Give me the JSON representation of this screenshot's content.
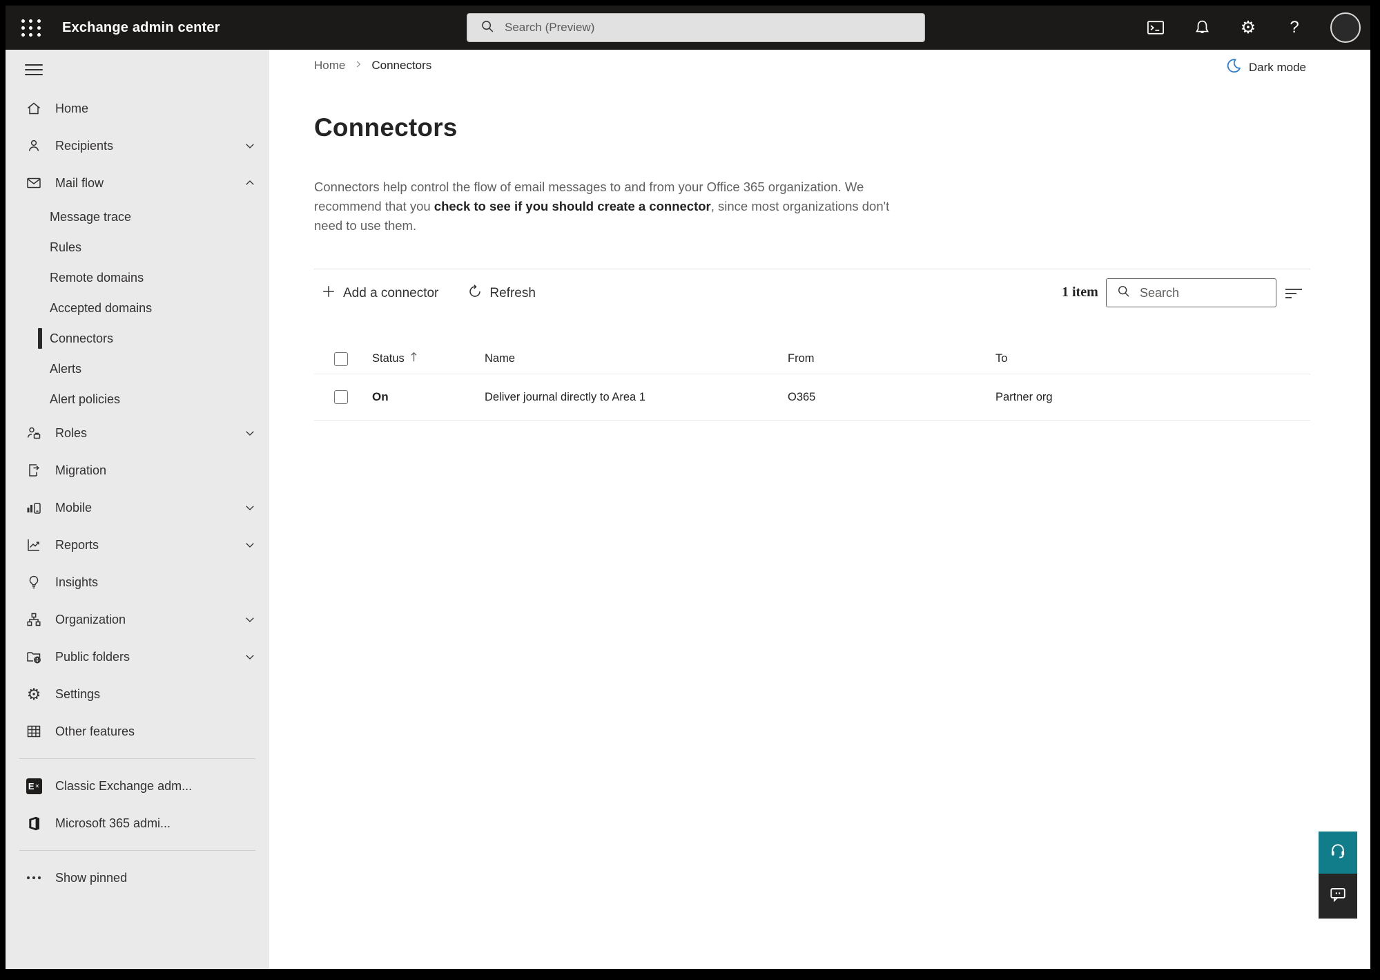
{
  "topbar": {
    "title": "Exchange admin center",
    "search_placeholder": "Search (Preview)",
    "help_label": "?",
    "gear_glyph": "⚙"
  },
  "sidebar": {
    "items": [
      {
        "label": "Home"
      },
      {
        "label": "Recipients"
      },
      {
        "label": "Mail flow"
      },
      {
        "label": "Message trace"
      },
      {
        "label": "Rules"
      },
      {
        "label": "Remote domains"
      },
      {
        "label": "Accepted domains"
      },
      {
        "label": "Connectors"
      },
      {
        "label": "Alerts"
      },
      {
        "label": "Alert policies"
      },
      {
        "label": "Roles"
      },
      {
        "label": "Migration"
      },
      {
        "label": "Mobile"
      },
      {
        "label": "Reports"
      },
      {
        "label": "Insights"
      },
      {
        "label": "Organization"
      },
      {
        "label": "Public folders"
      },
      {
        "label": "Settings"
      },
      {
        "label": "Other features"
      },
      {
        "label": "Classic Exchange adm..."
      },
      {
        "label": "Microsoft 365 admi..."
      },
      {
        "label": "Show pinned"
      }
    ],
    "exchange_logo_letter": "E"
  },
  "main": {
    "breadcrumb": {
      "home": "Home",
      "current": "Connectors"
    },
    "dark_mode_label": "Dark mode",
    "title": "Connectors",
    "description": {
      "before": "Connectors help control the flow of email messages to and from your Office 365 organization. We recommend that you ",
      "strong": "check to see if you should create a connector",
      "after": ", since most organizations don't need to use them."
    },
    "toolbar": {
      "add_label": "Add a connector",
      "refresh_label": "Refresh"
    },
    "list": {
      "count": "1 item",
      "search_placeholder": "Search"
    },
    "table": {
      "headers": {
        "status": "Status",
        "name": "Name",
        "from": "From",
        "to": "To"
      },
      "rows": [
        {
          "status": "On",
          "name": "Deliver journal directly to Area 1",
          "from": "O365",
          "to": "Partner org"
        }
      ]
    }
  },
  "colors": {
    "topbar_bg": "#1b1a19",
    "sidebar_bg": "#eaeaea",
    "accent_teal": "#117d8a",
    "moon_blue": "#2b7cd3"
  }
}
